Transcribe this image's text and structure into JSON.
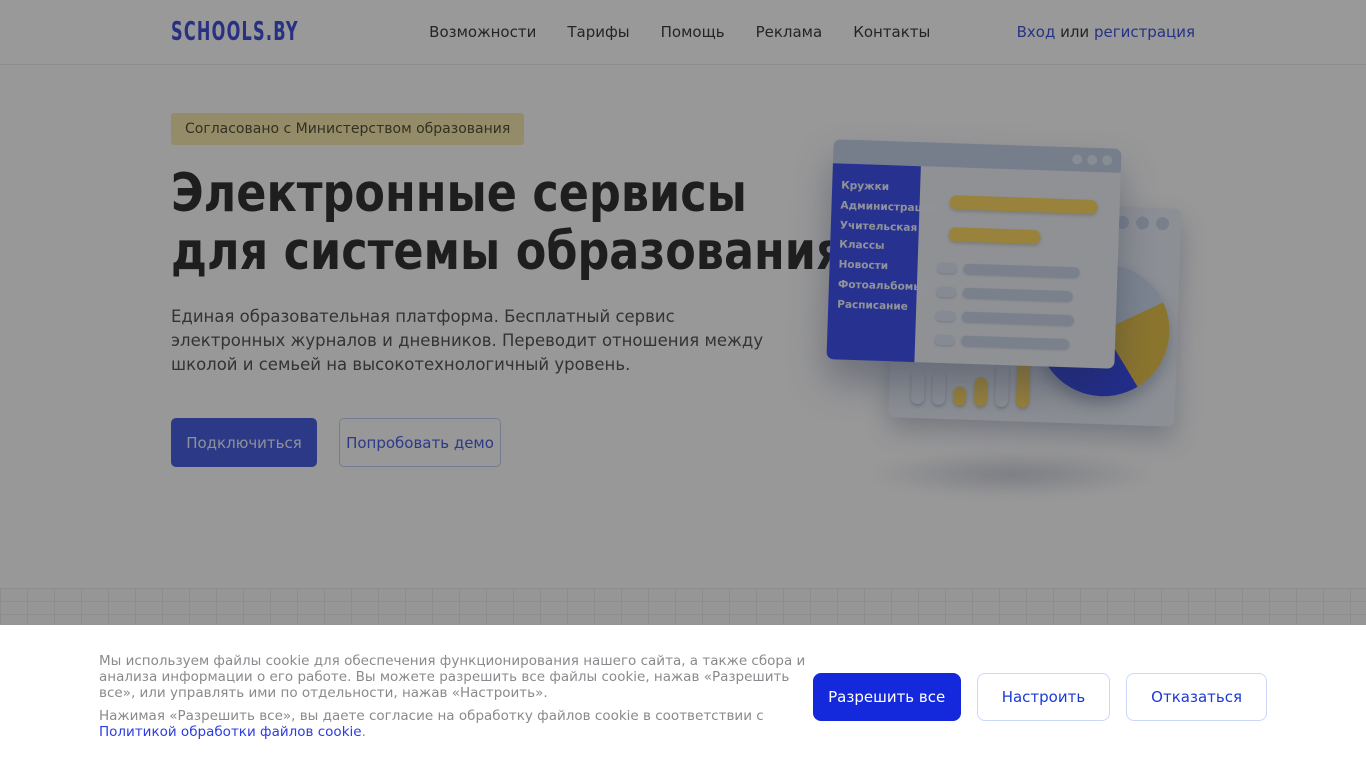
{
  "header": {
    "logo": "SCHOOLS.BY",
    "nav": [
      {
        "label": "Возможности"
      },
      {
        "label": "Тарифы"
      },
      {
        "label": "Помощь"
      },
      {
        "label": "Реклама"
      },
      {
        "label": "Контакты"
      }
    ],
    "auth": {
      "login": "Вход",
      "or": " или ",
      "register": "регистрация"
    }
  },
  "hero": {
    "badge": "Согласовано с Министерством образования",
    "title_line1": "Электронные сервисы",
    "title_line2": "для системы образования",
    "description": "Единая образовательная платформа. Бесплатный сервис электронных журналов и дневников. Переводит отношения между школой и семьей на высокотехнологичный уровень.",
    "primary_button": "Подключиться",
    "secondary_button": "Попробовать демо"
  },
  "illustration": {
    "sidebar_items": [
      "Кружки",
      "Администрация",
      "Учительская",
      "Классы",
      "Новости",
      "Фотоальбомы",
      "Расписание"
    ]
  },
  "cookie_banner": {
    "paragraph1": "Мы используем файлы cookie для обеспечения функционирования нашего сайта, а также сбора и анализа информации о его работе. Вы можете разрешить все файлы cookie, нажав «Разрешить все», или управлять ими по отдельности, нажав «Настроить».",
    "paragraph2_prefix": "Нажимая «Разрешить все», вы даете согласие на обработку файлов cookie в соответствии с ",
    "link": "Политикой обработки файлов cookie",
    "paragraph2_suffix": ".",
    "buttons": {
      "allow_all": "Разрешить все",
      "configure": "Настроить",
      "decline": "Отказаться"
    }
  },
  "colors": {
    "brand_blue": "#4a5fe0",
    "cookie_blue": "#1428dc",
    "sidebar_blue": "#4254f0",
    "accent_yellow": "#ffd964",
    "badge_bg": "#f7e9ad"
  }
}
